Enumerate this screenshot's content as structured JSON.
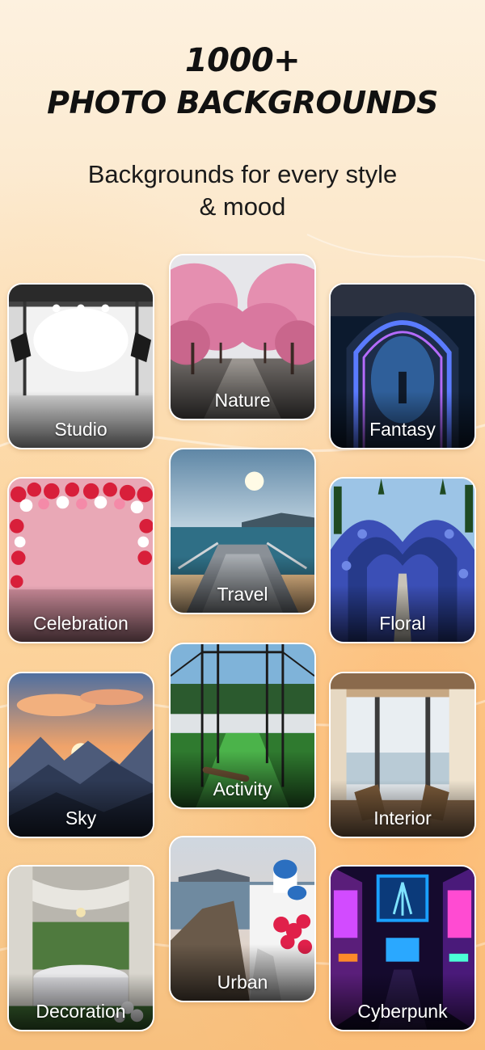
{
  "header": {
    "title_line1": "1000+",
    "title_line2": "PHOTO BACKGROUNDS",
    "subtitle_line1": "Backgrounds for every style",
    "subtitle_line2": "& mood"
  },
  "categories": [
    {
      "label": "Studio"
    },
    {
      "label": "Nature"
    },
    {
      "label": "Fantasy"
    },
    {
      "label": "Celebration"
    },
    {
      "label": "Travel"
    },
    {
      "label": "Floral"
    },
    {
      "label": "Sky"
    },
    {
      "label": "Activity"
    },
    {
      "label": "Interior"
    },
    {
      "label": "Decoration"
    },
    {
      "label": "Urban"
    },
    {
      "label": "Cyberpunk"
    }
  ],
  "colors": {
    "background_top": "#fdf1df",
    "background_bottom": "#f7c07e",
    "title_text": "#111111",
    "label_text": "#ffffff"
  }
}
